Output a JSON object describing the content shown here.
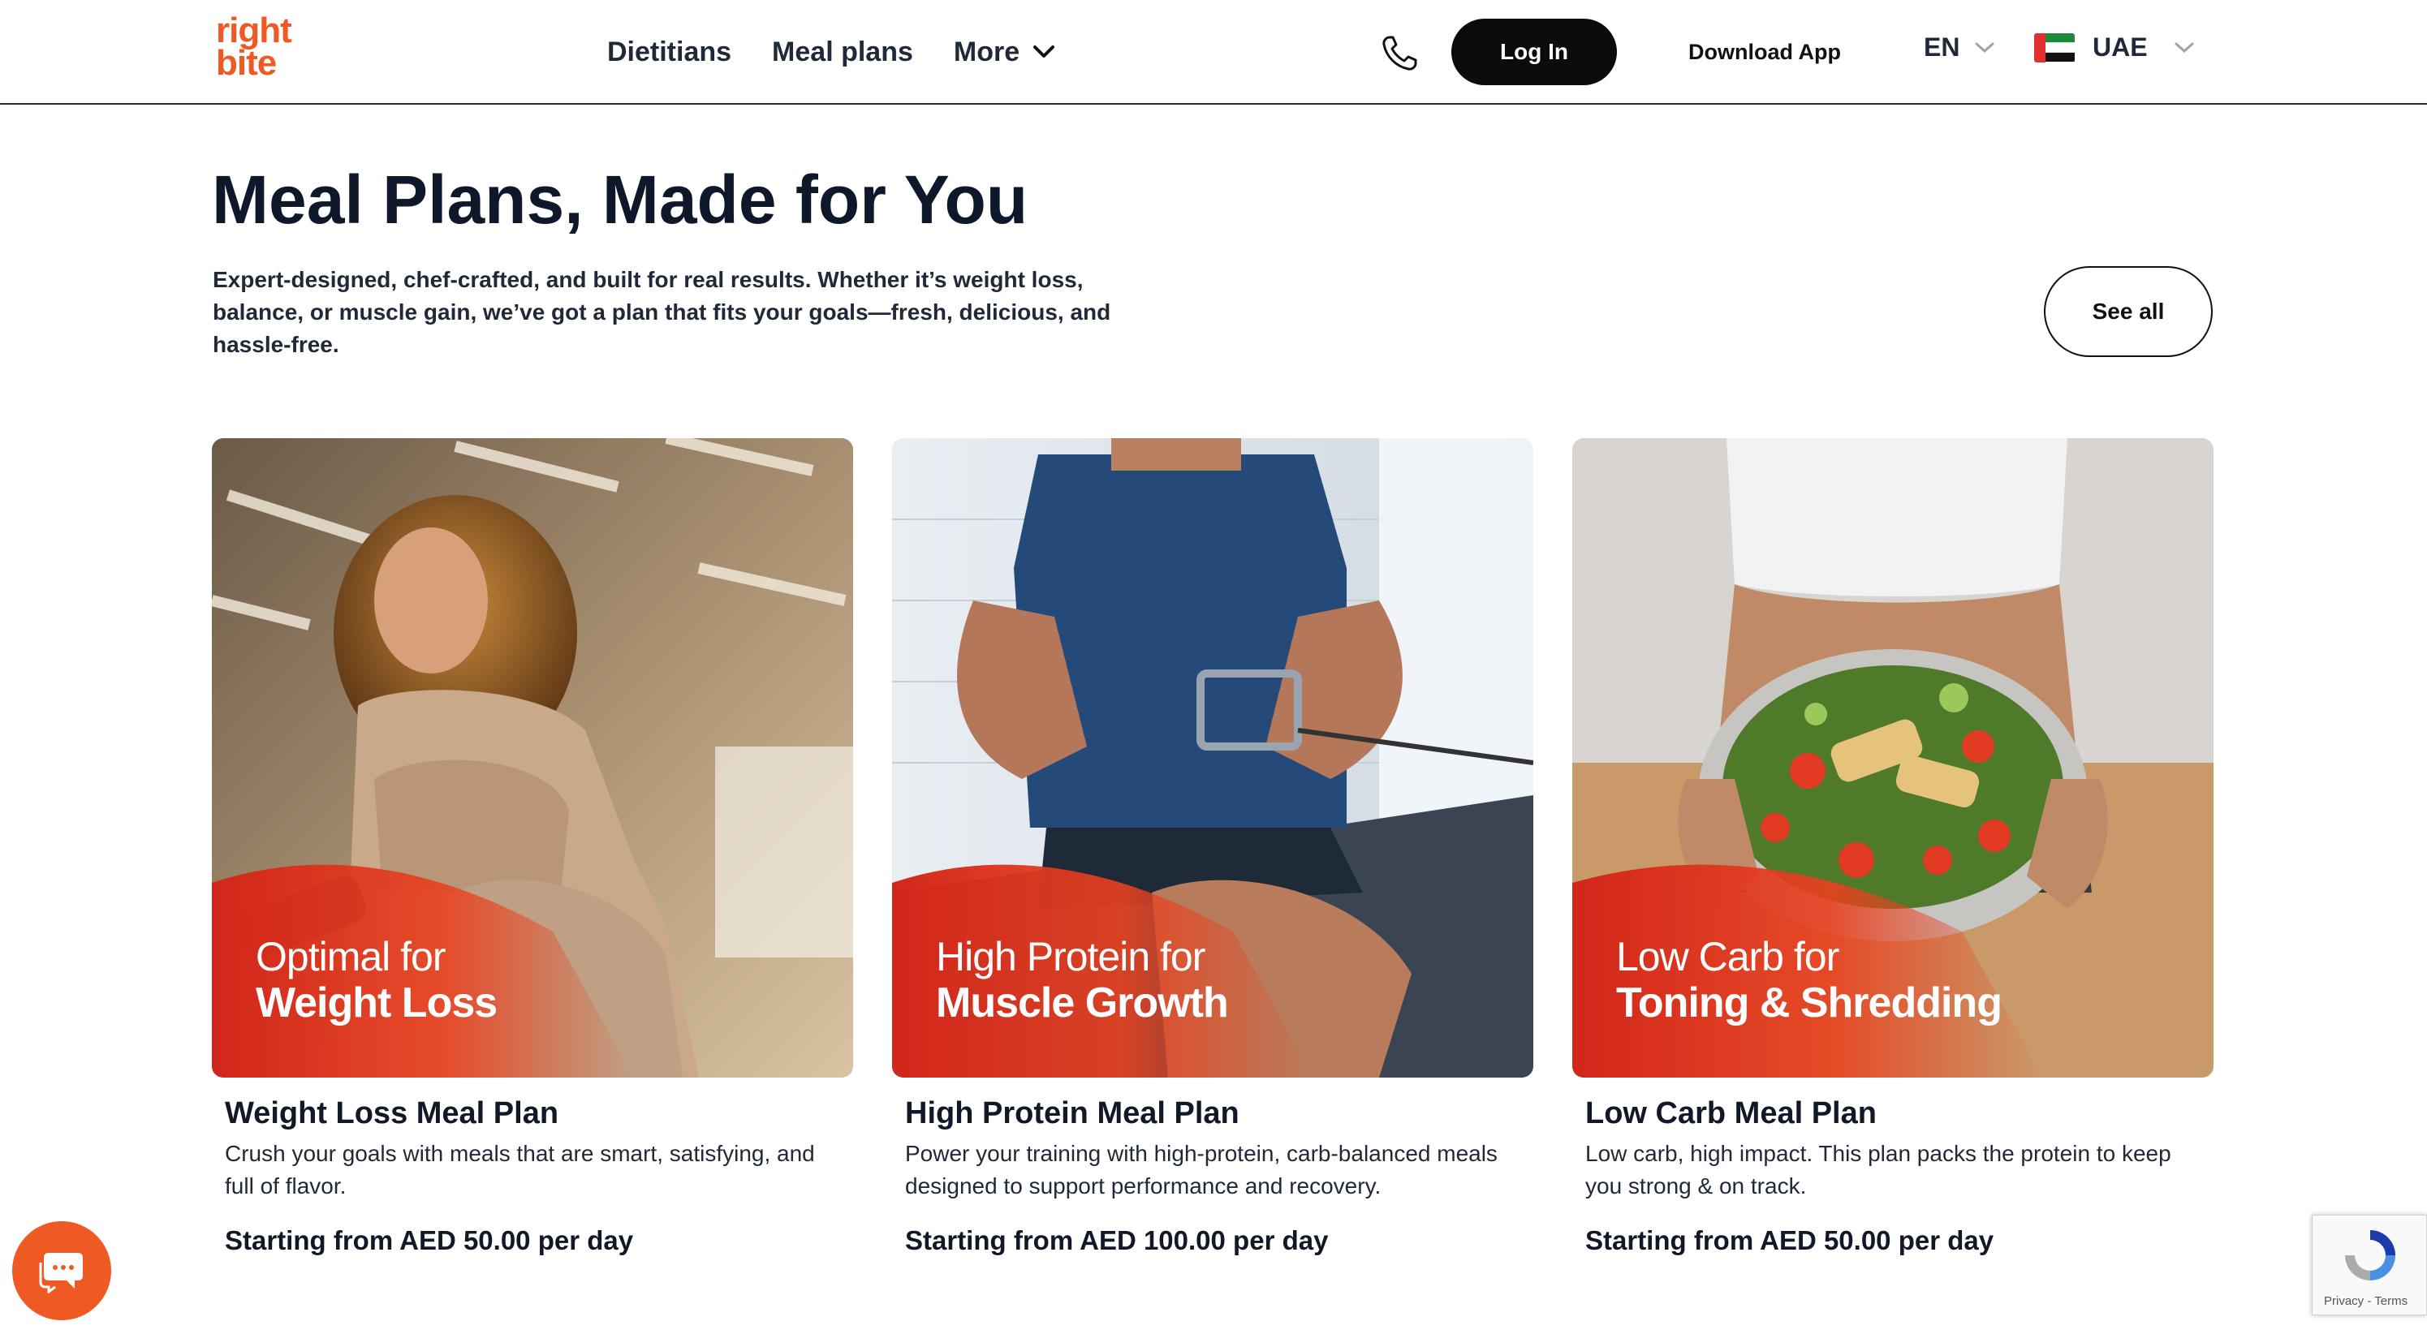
{
  "brand": {
    "logo_line1": "right",
    "logo_line2": "bite",
    "accent": "#ef5a24"
  },
  "nav": {
    "items": [
      "Dietitians",
      "Meal plans"
    ],
    "more_label": "More"
  },
  "header": {
    "login_label": "Log In",
    "download_label": "Download App",
    "language": "EN",
    "country": "UAE",
    "phone_icon": "phone-icon"
  },
  "section": {
    "title": "Meal Plans, Made for You",
    "subtitle": "Expert-designed, chef-crafted, and built for real results. Whether it’s weight loss, balance, or muscle gain, we’ve got a plan that fits your goals—fresh, delicious, and hassle-free.",
    "see_all_label": "See all"
  },
  "cards": [
    {
      "overlay_line1": "Optimal for",
      "overlay_line2": "Weight Loss",
      "title": "Weight Loss Meal Plan",
      "description": "Crush your goals with meals that are smart, satisfying, and full of flavor.",
      "price": "Starting from AED 50.00 per day"
    },
    {
      "overlay_line1": "High Protein for",
      "overlay_line2": "Muscle Growth",
      "title": "High Protein Meal Plan",
      "description": "Power your training with high-protein, carb-balanced meals designed to support performance and recovery.",
      "price": "Starting from AED 100.00 per day"
    },
    {
      "overlay_line1": "Low Carb for",
      "overlay_line2": "Toning & Shredding",
      "title": "Low Carb Meal Plan",
      "description": "Low carb, high impact. This plan packs the protein to keep you strong & on track.",
      "price": "Starting from AED 50.00 per day"
    }
  ],
  "widgets": {
    "chat_icon": "chat-icon",
    "recaptcha_text": "Privacy - Terms"
  }
}
